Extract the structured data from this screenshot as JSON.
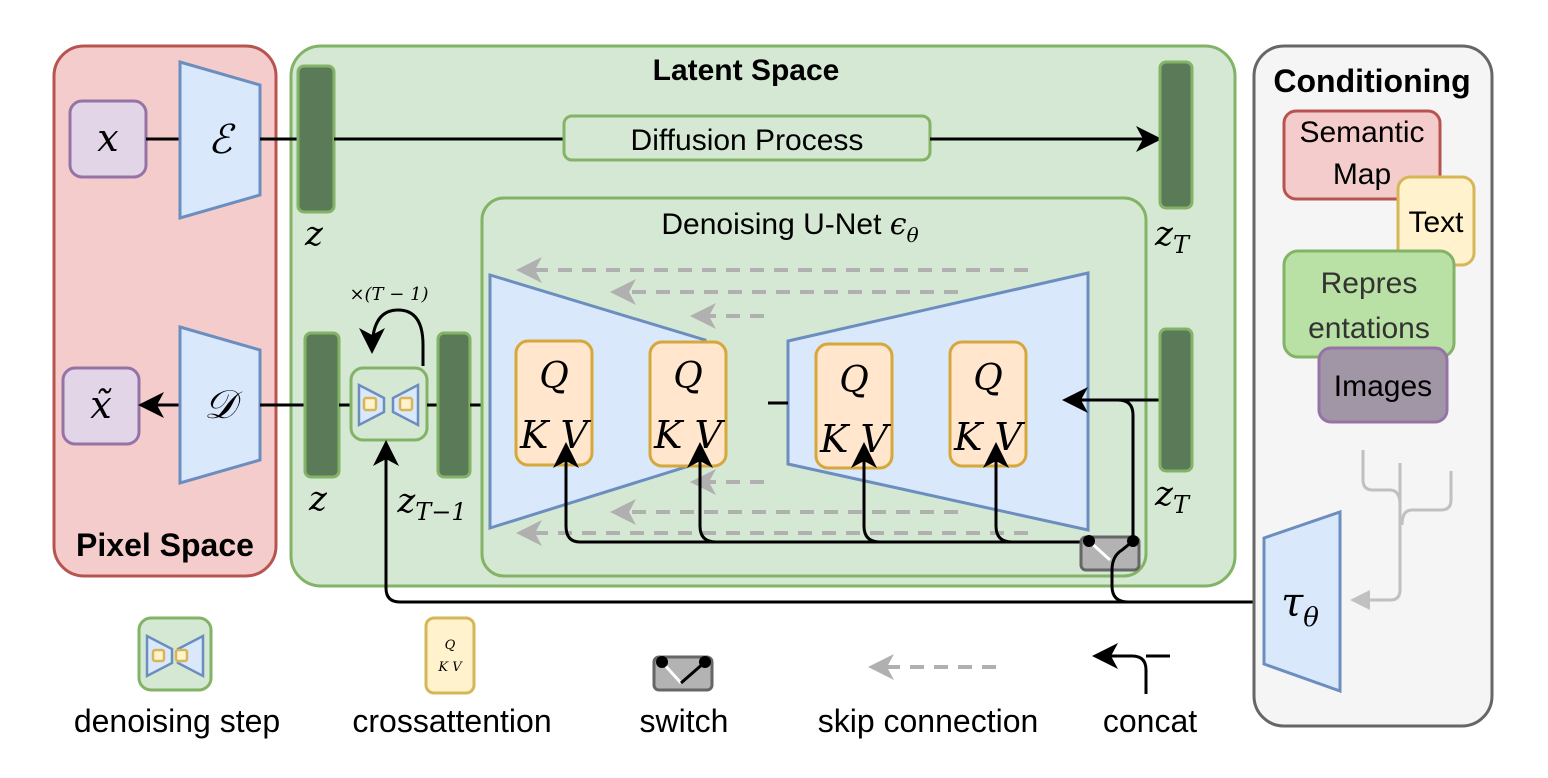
{
  "colors": {
    "pixel_fill": "#f4cccc",
    "pixel_stroke": "#b85450",
    "latent_fill": "#d5e8d4",
    "latent_stroke": "#82b366",
    "latent_bar": "#5a7a58",
    "cond_fill": "#f5f5f5",
    "cond_stroke": "#666666",
    "encoder_fill": "#dae8fc",
    "encoder_stroke": "#6c8ebf",
    "io_fill": "#e1d5e7",
    "io_stroke": "#9673a6",
    "qkv_fill": "#ffe6cc",
    "qkv_stroke": "#d6a73b",
    "text_fill": "#fff2cc",
    "text_stroke": "#d6b656",
    "repr_fill": "#b9e0a5",
    "images_fill": "#a096a6",
    "switch_fill": "#b3b3b3",
    "skip_color": "#b0b0b0"
  },
  "pixel_space": {
    "title": "Pixel Space",
    "input_label": "x",
    "output_label": "x̃",
    "encoder_label": "ℰ",
    "decoder_label": "𝒟"
  },
  "latent_space": {
    "title": "Latent Space",
    "diffusion_label": "Diffusion Process",
    "z_label": "z",
    "zT_label": "z",
    "zT_sub": "T",
    "z_bottom_label": "z",
    "zT1_label": "z",
    "zT1_sub": "T−1",
    "zT_bottom_label": "z",
    "zT_bottom_sub": "T",
    "repeat_label": "×(T − 1)",
    "unet": {
      "title": "Denoising U-Net ",
      "title_symbol": "ϵ",
      "title_sub": "θ",
      "blocks": [
        {
          "q": "Q",
          "kv": "K V"
        },
        {
          "q": "Q",
          "kv": "K V"
        },
        {
          "q": "Q",
          "kv": "K V"
        },
        {
          "q": "Q",
          "kv": "K V"
        }
      ]
    }
  },
  "conditioning": {
    "title": "Conditioning",
    "items": [
      {
        "label_lines": [
          "Semantic",
          "Map"
        ]
      },
      {
        "label_lines": [
          "Text"
        ]
      },
      {
        "label_lines": [
          "Repres",
          "entations"
        ]
      },
      {
        "label_lines": [
          "Images"
        ]
      }
    ],
    "tau_label": "τ",
    "tau_sub": "θ"
  },
  "legend": {
    "items": [
      {
        "label": "denoising step",
        "icon": "denoising-step-icon"
      },
      {
        "label": "crossattention",
        "icon": "crossattention-icon",
        "q": "Q",
        "kv": "K V"
      },
      {
        "label": "switch",
        "icon": "switch-icon"
      },
      {
        "label": "skip connection",
        "icon": "skip-connection-icon"
      },
      {
        "label": "concat",
        "icon": "concat-icon"
      }
    ]
  }
}
